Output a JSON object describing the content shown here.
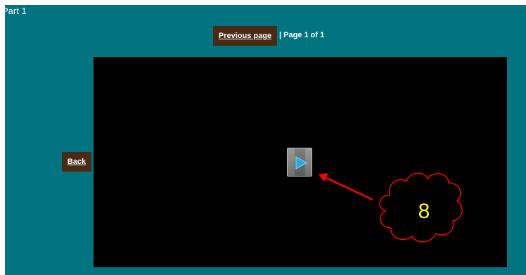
{
  "header": {
    "title": "Part 1"
  },
  "pagination": {
    "previous_label": "Previous page",
    "page_info": "| Page 1 of 1"
  },
  "navigation": {
    "back_label": "Back"
  },
  "player": {
    "play_icon": "play-icon"
  },
  "annotation": {
    "number": "8"
  },
  "colors": {
    "background": "#007480",
    "button": "#4a2a14",
    "annotation": "#ff0000",
    "number": "#ffff00"
  }
}
